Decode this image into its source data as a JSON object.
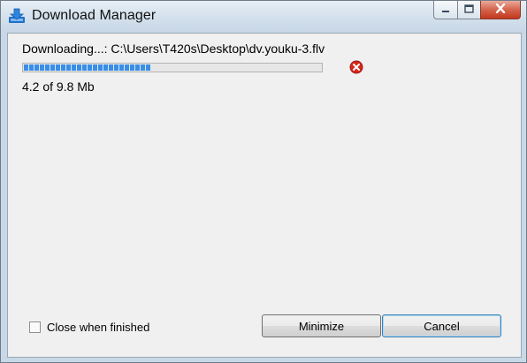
{
  "window": {
    "title": "Download Manager",
    "icons": {
      "app": "download-arrow-icon",
      "minimize": "minimize-icon",
      "maximize": "maximize-icon",
      "close": "close-icon"
    }
  },
  "download": {
    "status_line": "Downloading...: C:\\Users\\T420s\\Desktop\\dv.youku-3.flv",
    "progress_fraction": 0.43,
    "size_text": "4.2 of 9.8 Mb",
    "cancel_icon": "cancel-x-icon"
  },
  "footer": {
    "close_when_finished_label": "Close when finished",
    "close_when_finished_checked": false,
    "minimize_label": "Minimize",
    "cancel_label": "Cancel"
  },
  "colors": {
    "progress": "#3a8ee6",
    "close_button": "#c2381e",
    "cancel_icon": "#d9261c"
  }
}
